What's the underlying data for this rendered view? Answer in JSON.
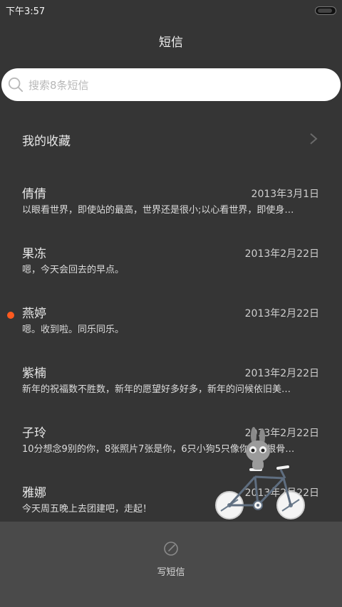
{
  "status": {
    "time": "下午3:57"
  },
  "header": {
    "title": "短信"
  },
  "search": {
    "placeholder": "搜索8条短信"
  },
  "favorites": {
    "label": "我的收藏"
  },
  "messages": [
    {
      "name": "倩倩",
      "date": "2013年3月1日",
      "snippet": "以眼看世界，即使站的最高，世界还是很小;以心看世界，即使身…",
      "unread": false
    },
    {
      "name": "果冻",
      "date": "2013年2月22日",
      "snippet": "嗯，今天会回去的早点。",
      "unread": false
    },
    {
      "name": "燕婷",
      "date": "2013年2月22日",
      "snippet": "嗯。收到啦。同乐同乐。",
      "unread": true
    },
    {
      "name": "紫楠",
      "date": "2013年2月22日",
      "snippet": "新年的祝福数不胜数，新年的愿望好多好多，新年的问候依旧美…",
      "unread": false
    },
    {
      "name": "子玲",
      "date": "2013年2月22日",
      "snippet": "10分想念9别的你，8张照片7张是你，6只小狗5只像你， 4根骨…",
      "unread": false
    },
    {
      "name": "雅娜",
      "date": "2013年2月22日",
      "snippet": "今天周五晚上去团建吧，走起！",
      "unread": false
    }
  ],
  "bottom": {
    "compose_label": "写短信"
  },
  "colors": {
    "background": "#353535",
    "unread_dot": "#ff5a1f",
    "bottom_bar": "#4a4a4a"
  },
  "icons": {
    "search": "search-icon",
    "chevron": "chevron-right-icon",
    "compose": "compose-icon",
    "battery": "battery-icon"
  }
}
